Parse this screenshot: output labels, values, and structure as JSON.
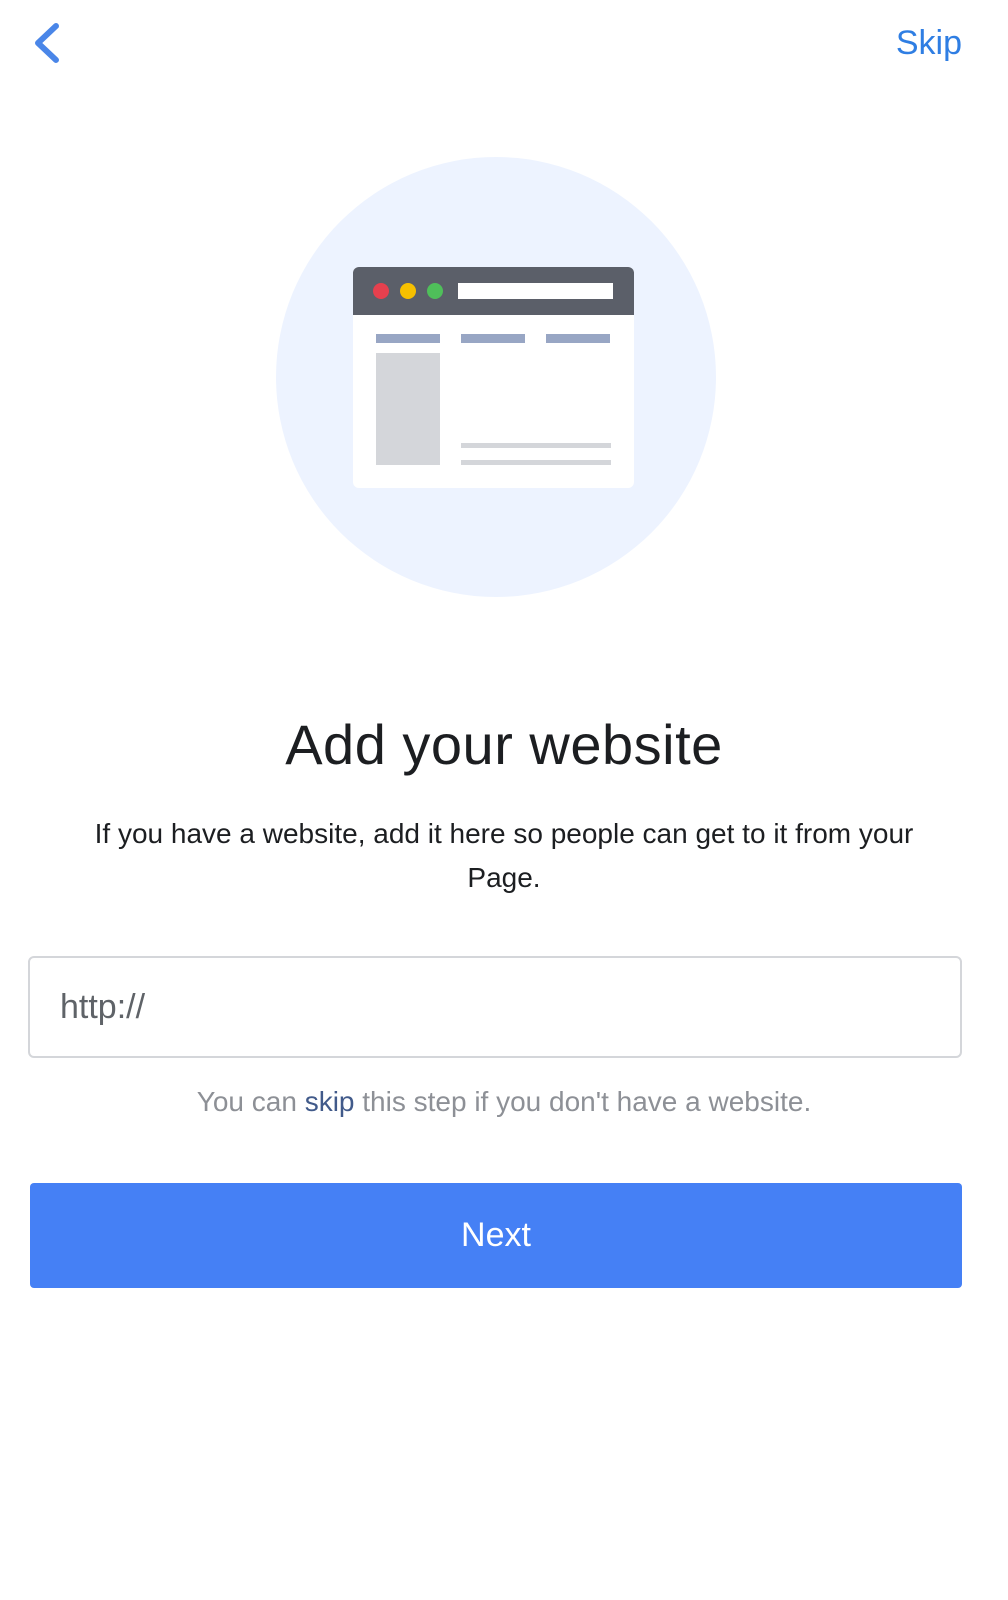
{
  "header": {
    "back_icon": "chevron-left-icon",
    "skip_label": "Skip"
  },
  "illustration": {
    "icon": "browser-window-icon",
    "circle_color": "#edf3ff",
    "window_bar_color": "#5b5f69",
    "dot_colors": [
      "#e5404e",
      "#f6c000",
      "#4fbf5a"
    ]
  },
  "title": "Add your website",
  "description": "If you have a website, add it here so people can get to it from your Page.",
  "website_input": {
    "placeholder": "http://",
    "value": ""
  },
  "hint": {
    "before": "You can ",
    "link": "skip",
    "after": " this step if you don't have a website."
  },
  "next_button_label": "Next",
  "colors": {
    "accent": "#4580f5",
    "link": "#2f7ee3"
  }
}
